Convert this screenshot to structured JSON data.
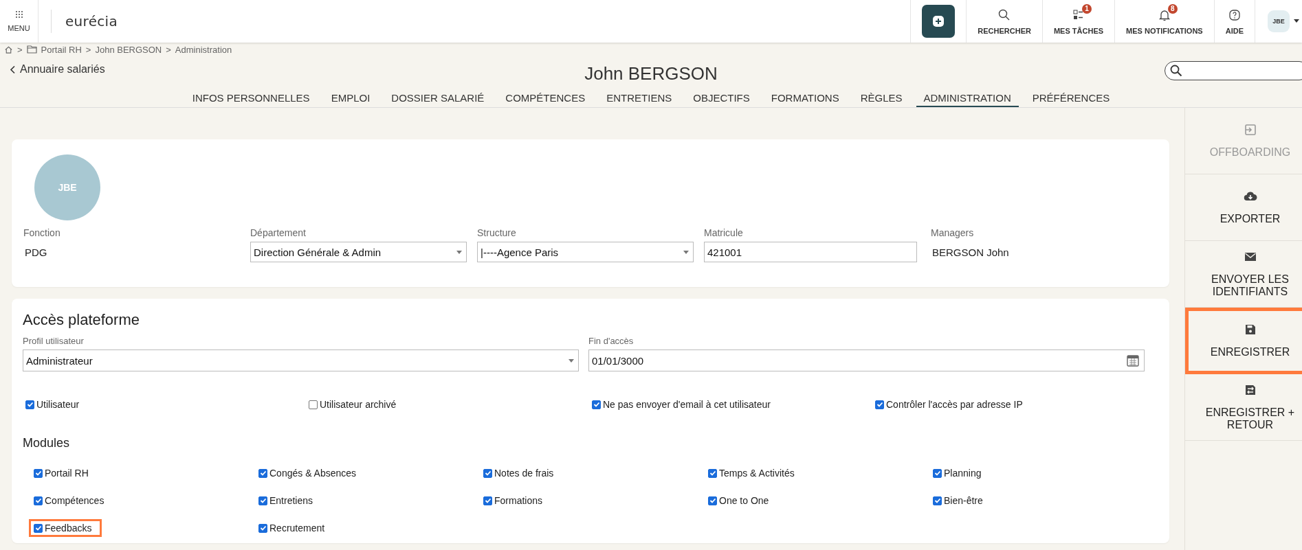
{
  "top_bar": {
    "menu_label": "MENU",
    "logo": "eurécia",
    "actions": [
      {
        "kind": "add"
      },
      {
        "kind": "search",
        "label": "RECHERCHER"
      },
      {
        "kind": "tasks",
        "label": "MES TÂCHES",
        "badge": "1"
      },
      {
        "kind": "notifications",
        "label": "MES NOTIFICATIONS",
        "badge": "8"
      },
      {
        "kind": "help",
        "label": "AIDE"
      }
    ],
    "avatar": "JBE"
  },
  "breadcrumb": {
    "separator": ">",
    "items": [
      "Portail RH",
      "John BERGSON",
      "Administration"
    ]
  },
  "back_link": "Annuaire salariés",
  "title": "John BERGSON",
  "tabs": [
    {
      "label": "INFOS PERSONNELLES",
      "selected": false
    },
    {
      "label": "EMPLOI",
      "selected": false
    },
    {
      "label": "DOSSIER SALARIÉ",
      "selected": false
    },
    {
      "label": "COMPÉTENCES",
      "selected": false
    },
    {
      "label": "ENTRETIENS",
      "selected": false
    },
    {
      "label": "OBJECTIFS",
      "selected": false
    },
    {
      "label": "FORMATIONS",
      "selected": false
    },
    {
      "label": "RÈGLES",
      "selected": false
    },
    {
      "label": "ADMINISTRATION",
      "selected": true
    },
    {
      "label": "PRÉFÉRENCES",
      "selected": false
    }
  ],
  "profile": {
    "avatar": "JBE",
    "fields": [
      {
        "kind": "text",
        "label": "Fonction",
        "value": "PDG"
      },
      {
        "kind": "select",
        "label": "Département",
        "value": "Direction Générale & Admin"
      },
      {
        "kind": "select",
        "label": "Structure",
        "value": "|----Agence Paris"
      },
      {
        "kind": "input",
        "label": "Matricule",
        "value": "421001"
      },
      {
        "kind": "text",
        "label": "Managers",
        "value": "BERGSON John"
      }
    ]
  },
  "access": {
    "title": "Accès plateforme",
    "fields": [
      {
        "kind": "select",
        "label": "Profil utilisateur",
        "value": "Administrateur"
      },
      {
        "kind": "date",
        "label": "Fin d'accès",
        "value": "01/01/3000"
      }
    ],
    "options": [
      {
        "label": "Utilisateur",
        "checked": true
      },
      {
        "label": "Utilisateur archivé",
        "checked": false
      },
      {
        "label": "Ne pas envoyer d'email à cet utilisateur",
        "checked": true
      },
      {
        "label": "Contrôler l'accès par adresse IP",
        "checked": true
      }
    ],
    "modules_title": "Modules",
    "modules": [
      {
        "label": "Portail RH",
        "checked": true,
        "highlighted": false
      },
      {
        "label": "Congés & Absences",
        "checked": true,
        "highlighted": false
      },
      {
        "label": "Notes de frais",
        "checked": true,
        "highlighted": false
      },
      {
        "label": "Temps & Activités",
        "checked": true,
        "highlighted": false
      },
      {
        "label": "Planning",
        "checked": true,
        "highlighted": false
      },
      {
        "label": "Compétences",
        "checked": true,
        "highlighted": false
      },
      {
        "label": "Entretiens",
        "checked": true,
        "highlighted": false
      },
      {
        "label": "Formations",
        "checked": true,
        "highlighted": false
      },
      {
        "label": "One to One",
        "checked": true,
        "highlighted": false
      },
      {
        "label": "Bien-être",
        "checked": true,
        "highlighted": false
      },
      {
        "label": "Feedbacks",
        "checked": true,
        "highlighted": true
      },
      {
        "label": "Recrutement",
        "checked": true,
        "highlighted": false
      }
    ]
  },
  "side_actions": [
    {
      "kind": "offboarding",
      "label": "OFFBOARDING",
      "disabled": true,
      "highlighted": false
    },
    {
      "kind": "export",
      "label": "EXPORTER",
      "disabled": false,
      "highlighted": false
    },
    {
      "kind": "mail",
      "label": "ENVOYER LES IDENTIFIANTS",
      "disabled": false,
      "highlighted": false
    },
    {
      "kind": "save",
      "label": "ENREGISTRER",
      "disabled": false,
      "highlighted": true
    },
    {
      "kind": "save_return",
      "label": "ENREGISTRER + RETOUR",
      "disabled": false,
      "highlighted": false
    }
  ]
}
